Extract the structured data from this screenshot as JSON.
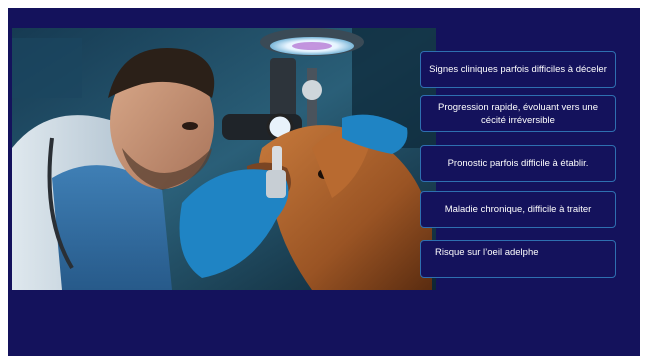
{
  "slide": {
    "image": {
      "description_icon": "veterinarian-examining-dog-eye-photo"
    },
    "bullets": [
      "Signes cliniques parfois difficiles à déceler",
      "Progression rapide, évoluant vers une cécité irréversible",
      "Pronostic parfois difficile à établir.",
      "Maladie chronique, difficile à traiter",
      "Risque sur l’oeil adelphe"
    ]
  },
  "colors": {
    "background": "#14125c",
    "box_border": "#2e6fb0",
    "text": "#ffffff"
  }
}
